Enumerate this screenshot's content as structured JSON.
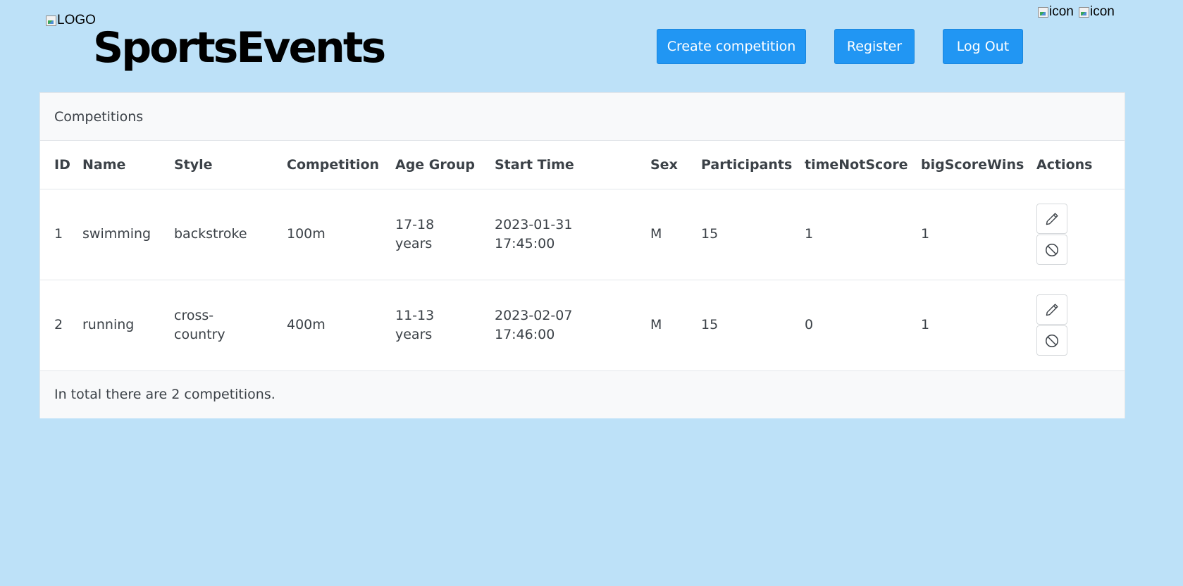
{
  "header": {
    "logo_alt": "LOGO",
    "brand": "SportsEvents",
    "icon_alt_1": "icon",
    "icon_alt_2": "icon",
    "buttons": {
      "create": "Create competition",
      "register": "Register",
      "logout": "Log Out"
    }
  },
  "card": {
    "title": "Competitions",
    "columns": [
      "ID",
      "Name",
      "Style",
      "Competition",
      "Age Group",
      "Start Time",
      "Sex",
      "Participants",
      "timeNotScore",
      "bigScoreWins",
      "Actions"
    ],
    "rows": [
      {
        "id": "1",
        "name": "swimming",
        "style": "backstroke",
        "competition": "100m",
        "age_group": "17-18 years",
        "start_time_date": "2023-01-31",
        "start_time_clock": "17:45:00",
        "sex": "M",
        "participants": "15",
        "timeNotScore": "1",
        "bigScoreWins": "1"
      },
      {
        "id": "2",
        "name": "running",
        "style": "cross-country",
        "competition": "400m",
        "age_group": "11-13 years",
        "start_time_date": "2023-02-07",
        "start_time_clock": "17:46:00",
        "sex": "M",
        "participants": "15",
        "timeNotScore": "0",
        "bigScoreWins": "1"
      }
    ],
    "footer": "In total there are 2 competitions."
  },
  "icons": {
    "edit": "pencil-icon",
    "delete": "ban-icon"
  },
  "colors": {
    "background": "#bde1f8",
    "button": "#2196f3"
  }
}
